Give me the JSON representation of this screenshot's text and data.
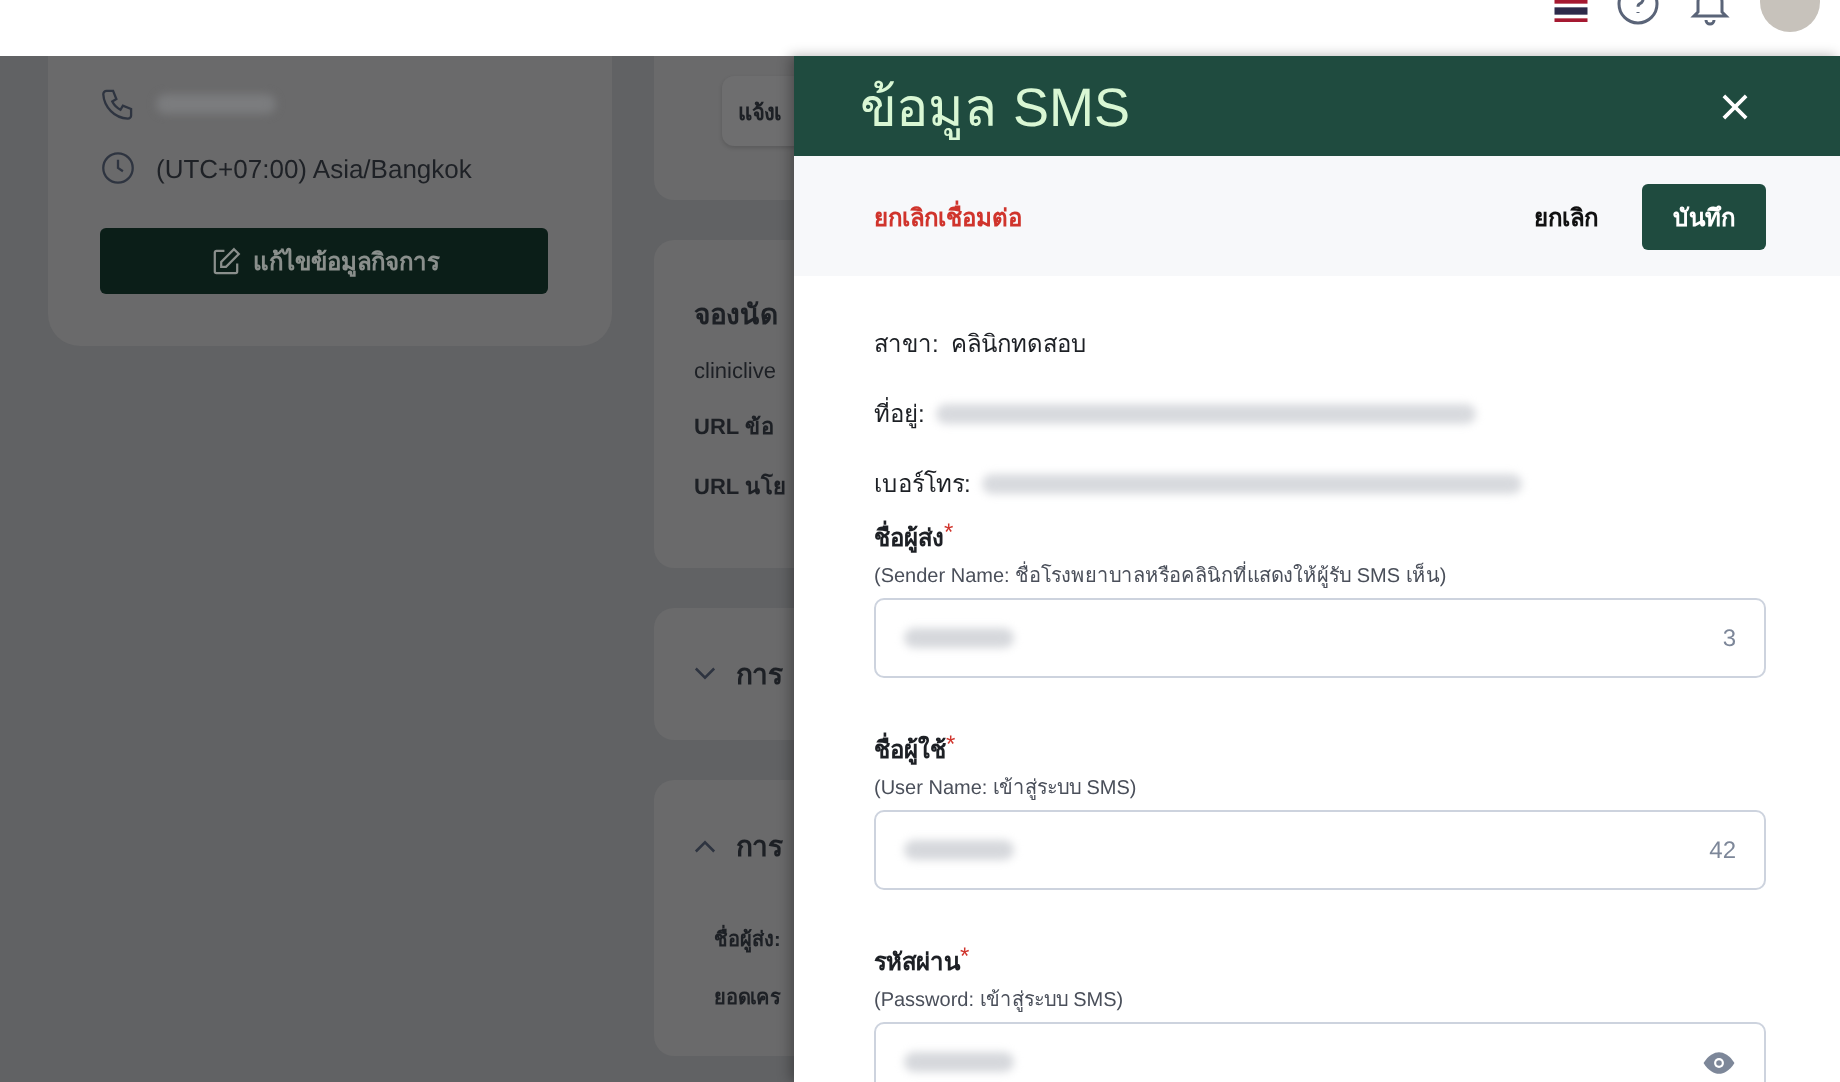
{
  "background": {
    "left_card": {
      "rows": [
        {
          "kind": "phone"
        },
        {
          "kind": "timezone",
          "text": "(UTC+07:00) Asia/Bangkok"
        }
      ],
      "edit_button": "แก้ไขข้อมูลกิจการ"
    },
    "right_cards": [
      {
        "kind": "button",
        "label": "แจ้งเ"
      },
      {
        "kind": "info",
        "title": "จองนัด",
        "lines": [
          {
            "text": "cliniclive",
            "bold": false
          },
          {
            "text": "URL ข้อ",
            "bold": true
          },
          {
            "text": "URL นโย",
            "bold": true
          }
        ]
      },
      {
        "kind": "section",
        "title": "การ",
        "expanded": false
      },
      {
        "kind": "section",
        "title": "การ",
        "expanded": true,
        "lines": [
          {
            "text": "ชื่อผู้ส่ง:",
            "bold": true
          },
          {
            "text": "ยอดเคร",
            "bold": true
          }
        ]
      }
    ]
  },
  "drawer": {
    "title": "ข้อมูล SMS",
    "actions": {
      "disconnect": "ยกเลิกเชื่อมต่อ",
      "cancel": "ยกเลิก",
      "save": "บันทึก"
    },
    "info": [
      {
        "kind": "text",
        "label": "สาขา:",
        "value": "คลินิกทดสอบ"
      },
      {
        "kind": "redacted",
        "label": "ที่อยู่:"
      },
      {
        "kind": "redacted",
        "label": "เบอร์โทร:"
      }
    ],
    "fields": [
      {
        "label": "ชื่อผู้ส่ง",
        "required_mark": "*",
        "hint": "(Sender Name: ชื่อโรงพยาบาลหรือคลินิกที่แสดงให้ผู้รับ SMS เห็น)",
        "kind": "counter",
        "counter": "3"
      },
      {
        "label": "ชื่อผู้ใช้",
        "required_mark": "*",
        "hint": "(User Name: เข้าสู่ระบบ SMS)",
        "kind": "counter",
        "counter": "42"
      },
      {
        "label": "รหัสผ่าน",
        "required_mark": "*",
        "hint": "(Password: เข้าสู่ระบบ SMS)",
        "kind": "password"
      }
    ]
  }
}
